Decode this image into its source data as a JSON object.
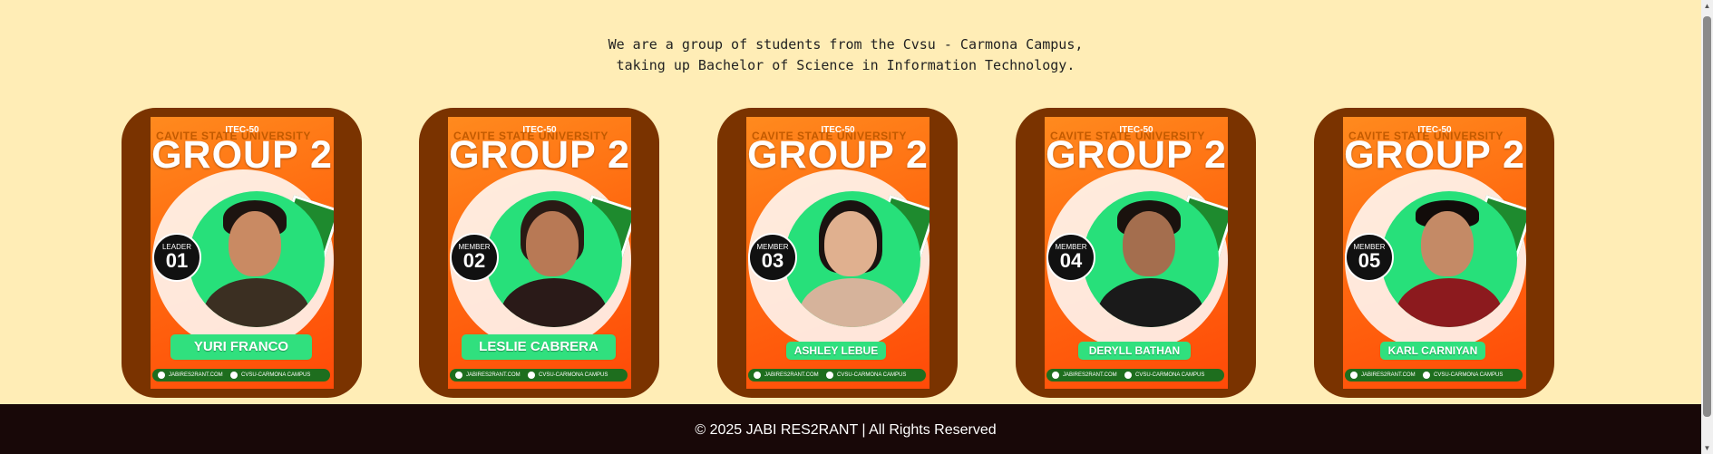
{
  "intro": {
    "line1": "We are a group of students from the Cvsu - Carmona Campus,",
    "line2": "taking up Bachelor of Science in Information Technology."
  },
  "poster_common": {
    "course": "ITEC-50",
    "university": "CAVITE STATE UNIVERSITY",
    "group": "GROUP 2",
    "email": "JABIRES2RANT.COM",
    "campus": "CVSU-CARMONA CAMPUS"
  },
  "members": [
    {
      "role": "LEADER",
      "number": "01",
      "name": "YURI FRANCO"
    },
    {
      "role": "MEMBER",
      "number": "02",
      "name": "LESLIE CABRERA"
    },
    {
      "role": "MEMBER",
      "number": "03",
      "name": "ASHLEY LEBUE"
    },
    {
      "role": "MEMBER",
      "number": "04",
      "name": "DERYLL BATHAN"
    },
    {
      "role": "MEMBER",
      "number": "05",
      "name": "KARL CARNIYAN"
    }
  ],
  "footer": {
    "text": "© 2025 JABI RES2RANT | All Rights Reserved"
  },
  "colors": {
    "background": "#FFEDB6",
    "card": "#7A3300",
    "footer": "#180808",
    "accent_green": "#30E07E"
  }
}
